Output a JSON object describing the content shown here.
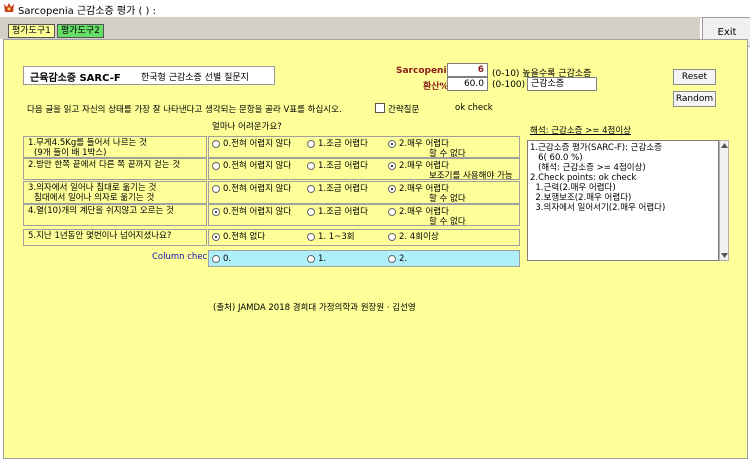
{
  "window": {
    "title": "Sarcopenia 근감소증 평가 ( ) :"
  },
  "tabs": [
    {
      "label": "평가도구1"
    },
    {
      "label": "평가도구2"
    }
  ],
  "exit_label": "Exit",
  "header": {
    "title": "근육감소증 SARC-F",
    "subtitle": "한국형 근감소증 선별 질문지",
    "score_label": "Sarcopenia",
    "score_value": "6",
    "score_range": "(0-10) 높을수록 근감소증",
    "converted_label": "환산%",
    "converted_value": "60.0",
    "converted_range": "(0-100)",
    "diagnosis_value": "근감소증"
  },
  "buttons": {
    "reset": "Reset",
    "random": "Random"
  },
  "instruction": "다음 글을 읽고 자신의 상태를 가장 잘 나타낸다고 생각되는 문항을 골라 V표를 하십시오.",
  "short_question_label": "간략질문",
  "ok_check": "ok check",
  "difficulty_header": "얼마나 어려운가요?",
  "questions": [
    {
      "line1": "1.무게4.5Kg를 들어서 나르는 것",
      "line2": "(9개 들이 배 1박스)",
      "options": [
        {
          "l1": "0.전혀 어렵지 않다",
          "l2": ""
        },
        {
          "l1": "1.조금 어렵다",
          "l2": ""
        },
        {
          "l1": "2.매우 어렵다",
          "l2": "할 수 없다"
        }
      ],
      "selected": 2
    },
    {
      "line1": "2.방안 한쪽 끝에서 다른 쪽 끝까지 걷는 것",
      "line2": "",
      "options": [
        {
          "l1": "0.전혀 어렵지 않다",
          "l2": ""
        },
        {
          "l1": "1.조금 어렵다",
          "l2": ""
        },
        {
          "l1": "2.매우 어렵다",
          "l2": "보조기를 사용해야 가능"
        }
      ],
      "selected": 2
    },
    {
      "line1": "3.의자에서 일어나 침대로 옮기는 것",
      "line2": "침대에서 일어나 의자로 옮기는 것",
      "options": [
        {
          "l1": "0.전혀 어렵지 않다",
          "l2": ""
        },
        {
          "l1": "1.조금 어렵다",
          "l2": ""
        },
        {
          "l1": "2.매우 어렵다",
          "l2": "할 수 없다"
        }
      ],
      "selected": 2
    },
    {
      "line1": "4.열(10)개의 계단을 쉬지않고 오르는 것",
      "line2": "",
      "options": [
        {
          "l1": "0.전혀 어렵지 않다",
          "l2": ""
        },
        {
          "l1": "1.조금 어렵다",
          "l2": ""
        },
        {
          "l1": "2.매우 어렵다",
          "l2": "할 수 없다"
        }
      ],
      "selected": 0
    },
    {
      "line1": "5.지난 1년동안 몇번이나 넘어지셨나요?",
      "line2": "",
      "options": [
        {
          "l1": "0.전혀 없다",
          "l2": ""
        },
        {
          "l1": "1. 1~3회",
          "l2": ""
        },
        {
          "l1": "2. 4회이상",
          "l2": ""
        }
      ],
      "selected": 0
    }
  ],
  "column_check": {
    "label": "Column check",
    "options": [
      "0.",
      "1.",
      "2."
    ]
  },
  "interpretation_label": "해석: 근감소증 >= 4점이상",
  "result_lines": [
    "1.근감소증 평가(SARC-F): 근감소증",
    "   6( 60.0 %)",
    "   (해석: 근감소증 >= 4점이상)",
    "2.Check points: ok check",
    "  1.근력(2.매우 어렵다)",
    "  2.보행보조(2.매우 어렵다)",
    "  3.의자에서 일어서기(2.매우 어렵다)"
  ],
  "source": "(출처) JAMDA 2018 경희대 가정의학과 원장원 · 김선영",
  "colors": {
    "panel": "#ffff99",
    "tab_active": "#66dd66",
    "column_check": "#aef0fa",
    "score_red": "#8b1a1a",
    "link_blue": "#1010c0"
  }
}
